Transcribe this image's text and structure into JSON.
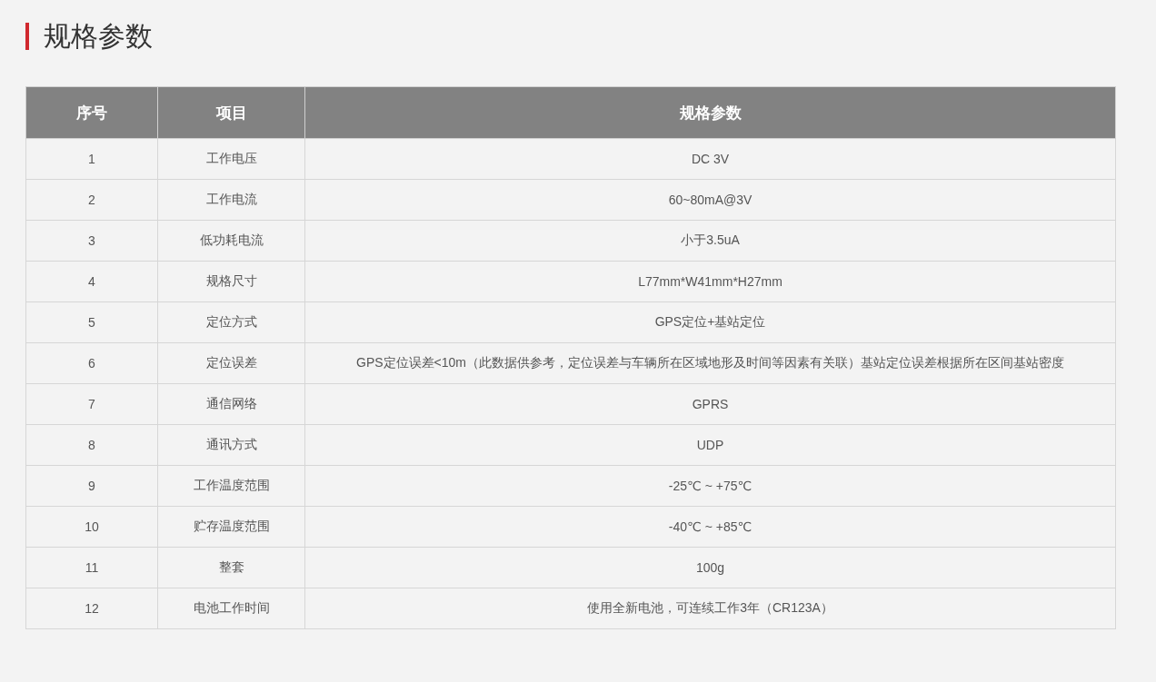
{
  "title": "规格参数",
  "table": {
    "columns": [
      "序号",
      "项目",
      "规格参数"
    ],
    "rows": [
      [
        "1",
        "工作电压",
        "DC 3V"
      ],
      [
        "2",
        "工作电流",
        "60~80mA@3V"
      ],
      [
        "3",
        "低功耗电流",
        "小于3.5uA"
      ],
      [
        "4",
        "规格尺寸",
        "L77mm*W41mm*H27mm"
      ],
      [
        "5",
        "定位方式",
        "GPS定位+基站定位"
      ],
      [
        "6",
        "定位误差",
        "GPS定位误差<10m（此数据供参考，定位误差与车辆所在区域地形及时间等因素有关联）基站定位误差根据所在区间基站密度"
      ],
      [
        "7",
        "通信网络",
        "GPRS"
      ],
      [
        "8",
        "通讯方式",
        "UDP"
      ],
      [
        "9",
        "工作温度范围",
        "-25℃ ~ +75℃"
      ],
      [
        "10",
        "贮存温度范围",
        "-40℃ ~ +85℃"
      ],
      [
        "11",
        "整套",
        "100g"
      ],
      [
        "12",
        "电池工作时间",
        "使用全新电池，可连续工作3年（CR123A）"
      ]
    ]
  }
}
